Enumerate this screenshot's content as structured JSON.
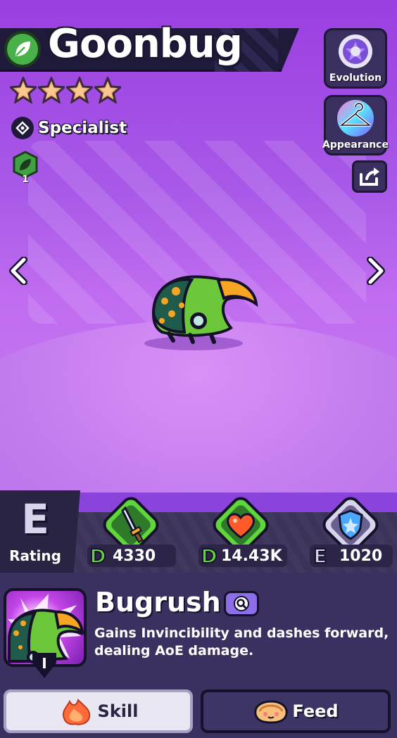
{
  "pet": {
    "name": "Goonbug",
    "stars": 4,
    "role": "Specialist",
    "badge_level": "1"
  },
  "side_buttons": {
    "evolution": "Evolution",
    "appearance": "Appearance"
  },
  "rating": {
    "grade": "E",
    "label": "Rating"
  },
  "stats": [
    {
      "icon": "sword-icon",
      "grade": "D",
      "value": "4330",
      "grade_color": "#5fd63a"
    },
    {
      "icon": "heart-icon",
      "grade": "D",
      "value": "14.43K",
      "grade_color": "#5fd63a"
    },
    {
      "icon": "shield-icon",
      "grade": "E",
      "value": "1020",
      "grade_color": "#d8d4ec"
    }
  ],
  "skill": {
    "name": "Bugrush",
    "level": "I",
    "description": "Gains Invincibility and dashes forward, dealing AoE damage."
  },
  "buttons": {
    "skill": "Skill",
    "feed": "Feed"
  },
  "colors": {
    "background": "#9a3fe0",
    "element_green": "#48b14a",
    "panel": "#3a3160"
  }
}
